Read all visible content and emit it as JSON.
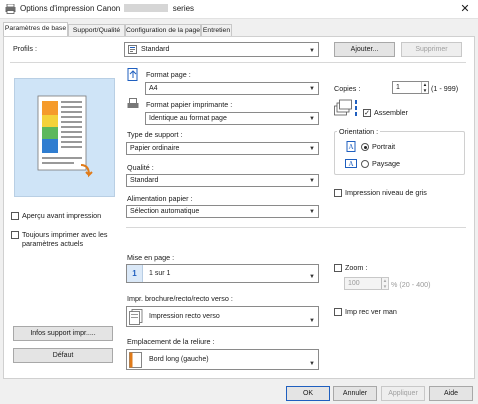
{
  "window": {
    "title": "Options d'impression Canon",
    "title_suffix": "series",
    "close_glyph": "✕"
  },
  "tabs": [
    {
      "label": "Paramètres de base",
      "active": true
    },
    {
      "label": "Support/Qualité",
      "active": false
    },
    {
      "label": "Configuration de la page",
      "active": false
    },
    {
      "label": "Entretien",
      "active": false
    }
  ],
  "profiles": {
    "label": "Profils :",
    "value": "Standard",
    "add_button": "Ajouter...",
    "delete_button": "Supprimer"
  },
  "page_format": {
    "label": "Format page :",
    "value": "A4"
  },
  "printer_paper": {
    "label": "Format papier imprimante :",
    "value": "Identique au format page"
  },
  "media_type": {
    "label": "Type de support :",
    "value": "Papier ordinaire"
  },
  "quality": {
    "label": "Qualité :",
    "value": "Standard"
  },
  "paper_source": {
    "label": "Alimentation papier :",
    "value": "Sélection automatique"
  },
  "copies": {
    "label": "Copies :",
    "value": "1",
    "range": "(1 - 999)",
    "collate_label": "Assembler",
    "collate_checked": true
  },
  "orientation": {
    "label": "Orientation :",
    "portrait_label": "Portrait",
    "landscape_label": "Paysage",
    "selected": "portrait"
  },
  "grayscale": {
    "label": "Impression niveau de gris",
    "checked": false
  },
  "preview": {
    "before_print_label": "Aperçu avant impression",
    "always_print_label": "Toujours imprimer avec les paramètres actuels"
  },
  "layout": {
    "label": "Mise en page :",
    "value": "1 sur 1",
    "icon_digit": "1"
  },
  "duplex": {
    "label": "Impr. brochure/recto/recto verso :",
    "value": "Impression recto verso"
  },
  "binding": {
    "label": "Emplacement de la reliure :",
    "value": "Bord long (gauche)"
  },
  "zoom": {
    "label": "Zoom :",
    "value": "100",
    "range": "% (20 - 400)",
    "checked": false
  },
  "mirror": {
    "label": "Imp rec ver man",
    "checked": false
  },
  "left_buttons": {
    "media_info": "Infos support impr.....",
    "defaults": "Défaut"
  },
  "footer": {
    "ok": "OK",
    "cancel": "Annuler",
    "apply": "Appliquer",
    "help": "Aide"
  },
  "colors": {
    "accent": "#1f5fbf",
    "preview_bg": "#cfe4f7"
  }
}
